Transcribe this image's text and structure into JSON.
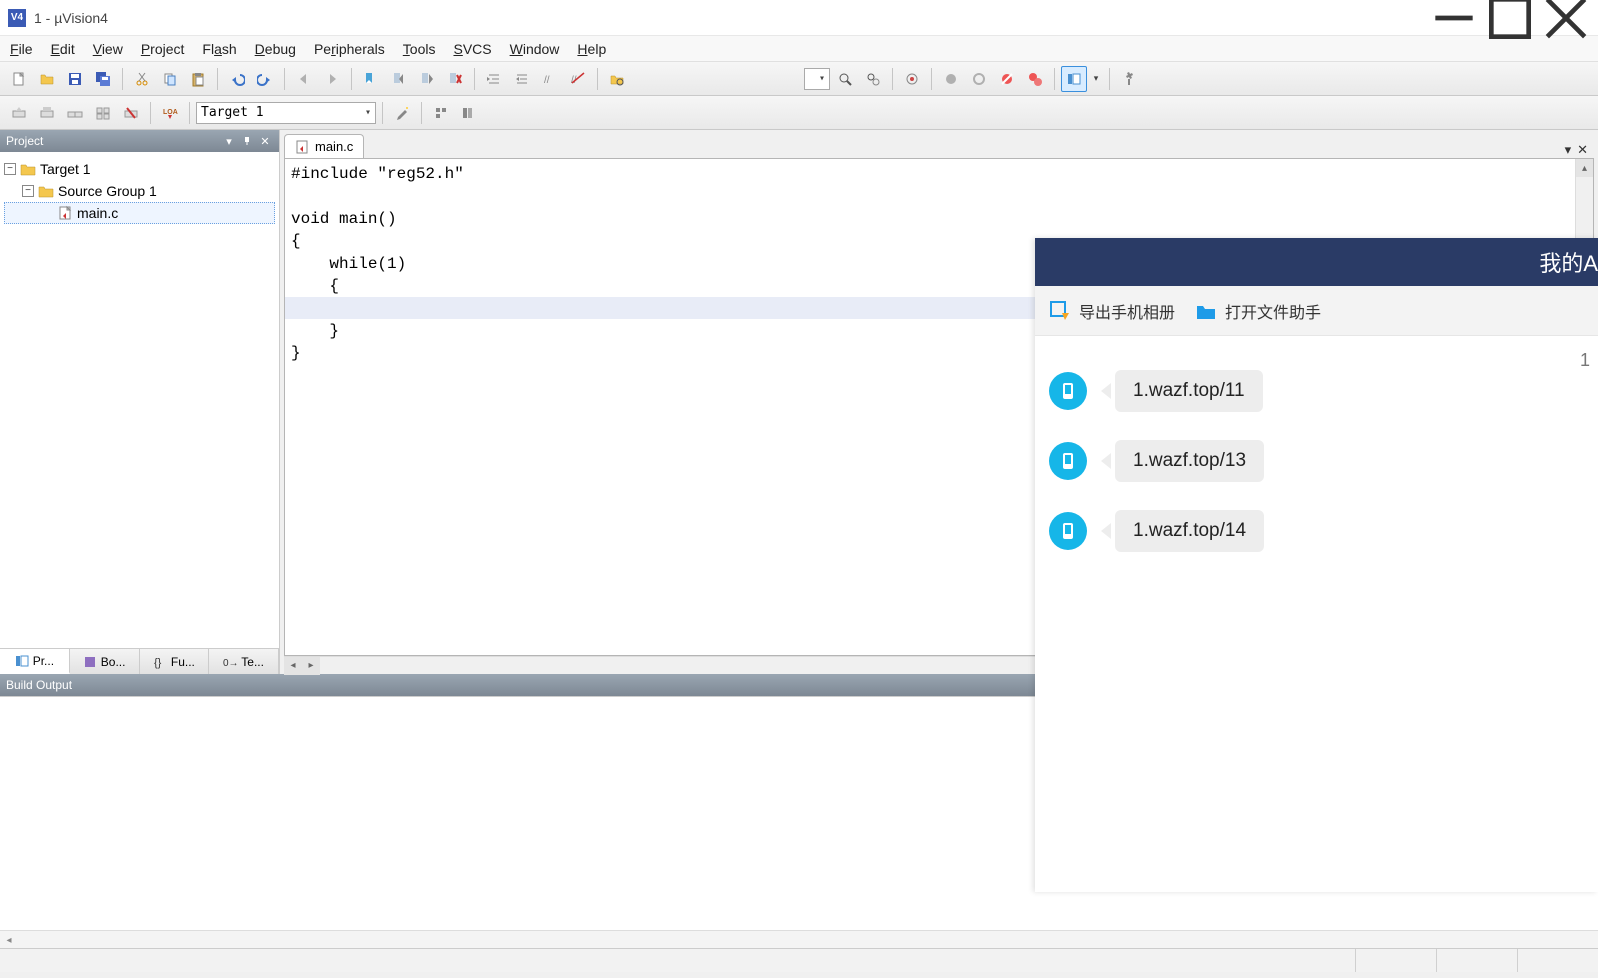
{
  "window": {
    "title": "1  - µVision4",
    "app_icon_text": "V4"
  },
  "menu": {
    "items": [
      "File",
      "Edit",
      "View",
      "Project",
      "Flash",
      "Debug",
      "Peripherals",
      "Tools",
      "SVCS",
      "Window",
      "Help"
    ]
  },
  "toolbar2": {
    "target_label": "Target 1"
  },
  "project_panel": {
    "title": "Project",
    "root": "Target 1",
    "group": "Source Group 1",
    "file": "main.c",
    "tabs": [
      "Pr...",
      "Bo...",
      "Fu...",
      "Te..."
    ]
  },
  "editor": {
    "tab_label": "main.c",
    "code_lines": [
      "#include \"reg52.h\"",
      "",
      "void main()",
      "{",
      "    while(1)",
      "    {",
      "",
      "    }",
      "}"
    ],
    "highlight_line_index": 6
  },
  "build_output": {
    "title": "Build Output"
  },
  "overlay": {
    "title_fragment": "我的A",
    "export_label": "导出手机相册",
    "open_label": "打开文件助手",
    "timestamp": "1",
    "messages": [
      "1.wazf.top/11",
      "1.wazf.top/13",
      "1.wazf.top/14"
    ]
  }
}
